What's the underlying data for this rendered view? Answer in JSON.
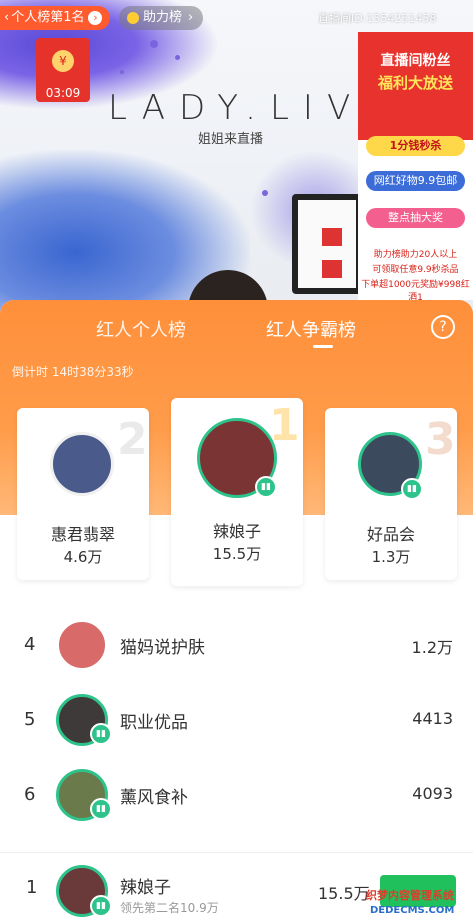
{
  "stream": {
    "personal_rank_chip": "个人榜第1名",
    "help_chip": "助力榜",
    "room_id": "直播间ID:1554251458",
    "logo": "LADY.LIVE",
    "logo_sub": "姐姐来直播",
    "red_envelope_timer": "03:09",
    "promo": {
      "title1": "直播间粉丝",
      "title2": "福利大放送",
      "pill1": "1分钱秒杀",
      "pill2": "网红好物9.9包邮",
      "pill3": "整点抽大奖",
      "fine1": "助力榜助力20人以上",
      "fine2": "可领取任意9.9秒杀品",
      "fine3": "下单超1000元奖励¥998红酒1"
    }
  },
  "ranking": {
    "tabs": [
      "红人个人榜",
      "红人争霸榜"
    ],
    "active_tab": 1,
    "help_icon": "?",
    "countdown": "倒计时 14时38分33秒",
    "podium": [
      {
        "rank": "2",
        "name": "惠君翡翠",
        "value": "4.6万"
      },
      {
        "rank": "1",
        "name": "辣娘子",
        "value": "15.5万"
      },
      {
        "rank": "3",
        "name": "好品会",
        "value": "1.3万"
      }
    ],
    "list": [
      {
        "rank": "4",
        "name": "猫妈说护肤",
        "score": "1.2万"
      },
      {
        "rank": "5",
        "name": "职业优品",
        "score": "4413"
      },
      {
        "rank": "6",
        "name": "薰风食补",
        "score": "4093"
      }
    ],
    "me": {
      "rank": "1",
      "name": "辣娘子",
      "subtitle": "领先第二名10.9万",
      "score": "15.5万"
    }
  },
  "watermark": {
    "line1": "织梦内容管理系统",
    "line2": "DEDECMS.COM"
  },
  "colors": {
    "orange": "#ff8f3a",
    "green": "#2ec38b",
    "red": "#e8322d"
  }
}
